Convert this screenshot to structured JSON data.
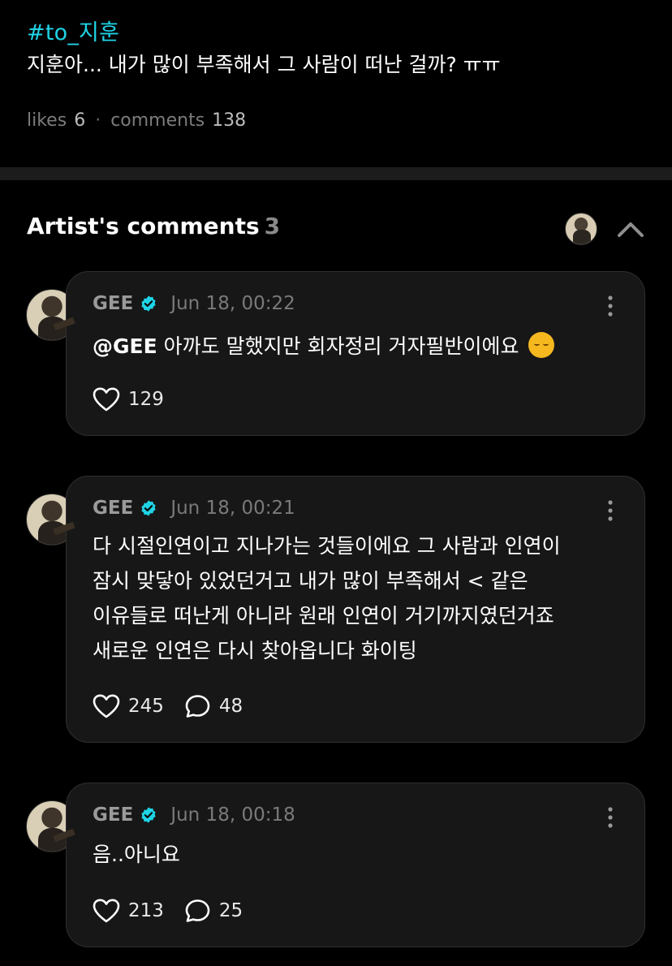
{
  "post": {
    "hashtag": "#to_지훈",
    "text": "지훈아... 내가 많이 부족해서 그 사람이 떠난 걸까? ㅠㅠ",
    "likes_label": "likes",
    "likes_count": "6",
    "separator": "·",
    "comments_label": "comments",
    "comments_count": "138"
  },
  "artist_comments": {
    "title": "Artist's comments",
    "count": "3"
  },
  "comments": [
    {
      "author": "GEE",
      "date": "Jun 18, 00:22",
      "mention": "@GEE",
      "text": "아까도 말했지만 회자정리 거자필반이에요",
      "emoji": "pensive-face",
      "likes": "129"
    },
    {
      "author": "GEE",
      "date": "Jun 18, 00:21",
      "lines": [
        "다 시절인연이고 지나가는 것들이에요 그 사람과 인연이",
        "잠시 맞닿아 있었던거고 내가 많이 부족해서 < 같은",
        "이유들로 떠난게 아니라 원래 인연이 거기까지였던거죠",
        "새로운 인연은 다시 찾아옵니다 화이팅"
      ],
      "likes": "245",
      "replies": "48"
    },
    {
      "author": "GEE",
      "date": "Jun 18, 00:18",
      "text": "음..아니요",
      "likes": "213",
      "replies": "25"
    }
  ],
  "colors": {
    "accent": "#1fd3e6",
    "background": "#000000",
    "card": "#171717",
    "verified": "#1fd3e6"
  },
  "icons": [
    "verified-badge-icon",
    "more-vertical-icon",
    "heart-icon",
    "comment-bubble-icon",
    "chevron-up-icon"
  ]
}
